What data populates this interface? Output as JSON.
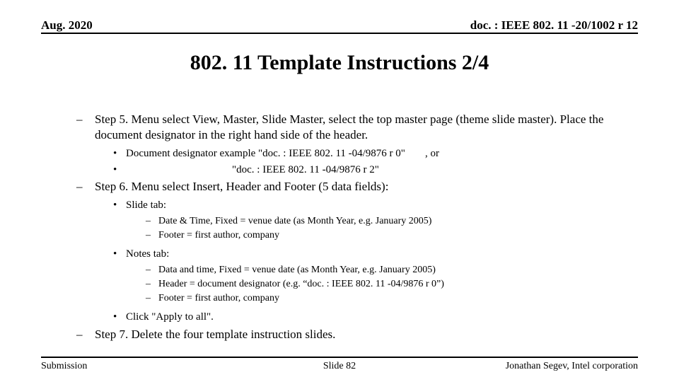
{
  "header": {
    "date": "Aug. 2020",
    "doc": "doc. : IEEE 802. 11 -20/1002 r 12"
  },
  "title": "802. 11 Template Instructions 2/4",
  "step5": {
    "text": "Step 5. Menu select View, Master, Slide Master, select the top master page (theme slide master).  Place the document designator in the right hand side of the header.",
    "example1a": "Document designator example \"doc. : IEEE 802. 11 -04/9876 r 0\"",
    "example1b": ", or",
    "example2": "\"doc. : IEEE 802. 11 -04/9876 r 2\""
  },
  "step6": {
    "text": "Step 6. Menu select Insert, Header and Footer (5 data fields):",
    "slide_tab": "Slide tab:",
    "slide_date": "Date & Time, Fixed =  venue date (as Month Year, e.g. January 2005)",
    "slide_footer": "Footer = first author, company",
    "notes_tab": "Notes tab:",
    "notes_date": "Data and time, Fixed = venue date (as Month Year, e.g. January 2005)",
    "notes_header": "Header = document designator (e.g. “doc. : IEEE 802. 11 -04/9876 r 0”)",
    "notes_footer": "Footer = first author, company",
    "apply": "Click \"Apply to all\"."
  },
  "step7": {
    "text": "Step 7. Delete the four template instruction slides."
  },
  "footer": {
    "left": "Submission",
    "center": "Slide 82",
    "right": "Jonathan Segev, Intel corporation"
  }
}
